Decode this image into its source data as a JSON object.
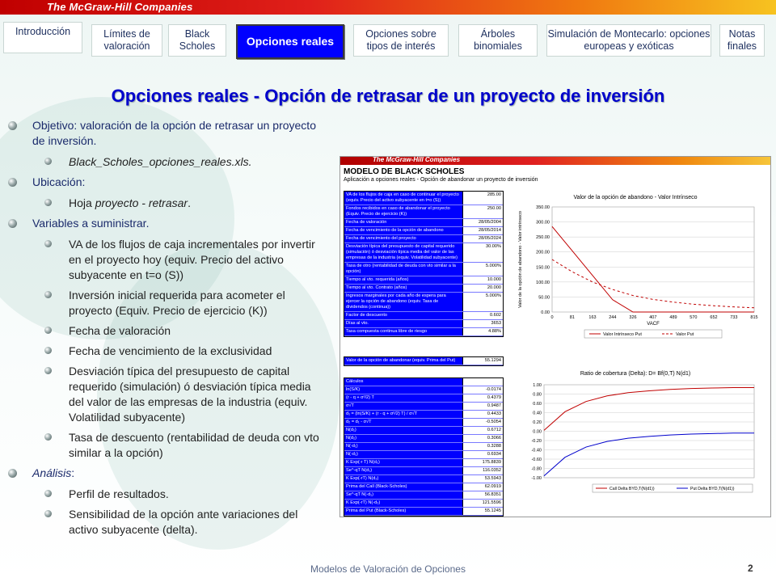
{
  "brand": "The McGraw-Hill Companies",
  "nav": [
    {
      "label": "Introducción"
    },
    {
      "label": "Límites de valoración"
    },
    {
      "label": "Black Scholes"
    },
    {
      "label": "Opciones reales"
    },
    {
      "label": "Opciones sobre tipos de interés"
    },
    {
      "label": "Árboles binomiales"
    },
    {
      "label": "Simulación de Montecarlo: opciones europeas y exóticas"
    },
    {
      "label": "Notas finales"
    }
  ],
  "title": "Opciones reales - Opción de retrasar de un proyecto de inversión",
  "bullets": {
    "objetivo_label": "Objetivo",
    "objetivo_text": ": valoración de la opción de retrasar un proyecto de inversión.",
    "file": "Black_Scholes_opciones_reales.xls.",
    "ubicacion_label": "Ubicación",
    "ubicacion_colon": ":",
    "hoja_prefix": "Hoja ",
    "hoja_name": "proyecto - retrasar",
    "hoja_suffix": ".",
    "variables_label": "Variables a suministrar.",
    "variables": [
      "VA de los flujos de caja incrementales por invertir en el proyecto hoy (equiv. Precio del activo subyacente en t=o (S))",
      "Inversión inicial requerida para acometer el proyecto (Equiv. Precio de ejercicio (K))",
      "Fecha de valoración",
      "Fecha de vencimiento de la exclusividad",
      "Desviación típica del presupuesto de capital requerido (simulación) ó desviación típica media del valor de las empresas de la industria (equiv. Volatilidad subyacente)",
      "Tasa de descuento (rentabilidad de deuda con vto similar a la opción)"
    ],
    "analisis_label": "Análisis",
    "analisis_colon": ":",
    "analisis": [
      "Perfil de resultados.",
      "Sensibilidad de la opción ante variaciones del activo subyacente (delta)."
    ]
  },
  "sheet": {
    "brand": "The McGraw-Hill Companies",
    "heading": "MODELO DE BLACK SCHOLES",
    "subheading": "Aplicación a opciones reales - Opción de abandonar un proyecto de inversión",
    "inputs": [
      {
        "label": "VA de los flujos de caja en caso de continuar el proyecto (equiv. Precio del activo subyacente en t=o (S))",
        "value": "285.00"
      },
      {
        "label": "Fondos recibidos en caso de abandonar el proyecto (Equiv. Precio de ejercicio (K))",
        "value": "250.00"
      },
      {
        "label": "Fecha de valoración",
        "value": "28/05/2004"
      },
      {
        "label": "Fecha de vencimiento de la opción de abandono",
        "value": "28/05/2014"
      },
      {
        "label": "Fecha de vencimiento del proyecto",
        "value": "28/05/2024"
      },
      {
        "label": "Desviación típica del presupuesto de capital requerido (simulación) ó desviación típica media del valor de las empresas de la industria (equiv. Volatilidad subyacente)",
        "value": "30.00%"
      },
      {
        "label": "Tasa de otro (rentabilidad de deuda con vto similar a la opción)",
        "value": "5.000%"
      },
      {
        "label": "Tiempo al vto. requerida (años)",
        "value": "10.000"
      },
      {
        "label": "Tiempo al vto. Contrato (años)",
        "value": "20.000"
      },
      {
        "label": "Ingresos marginales por cada año de espera para ejercer la opción de abandono (equiv. Tasa de dividendos (continua))",
        "value": "5.000%"
      },
      {
        "label": "Factor de descuento",
        "value": "0.602"
      },
      {
        "label": "Días al vto.",
        "value": "3653"
      },
      {
        "label": "Tasa compuesta continua libre de riesgo",
        "value": "4.88%"
      }
    ],
    "put_value_label": "Valor de la opción de abandonar (equiv. Prima del Put)",
    "put_value": "55.1294",
    "calc_header": "Cálculos",
    "calcs": [
      {
        "label": "ln(S/K)",
        "value": "-0.0174"
      },
      {
        "label": "(r - q + σ²/2) T",
        "value": "0.4379"
      },
      {
        "label": "σ√T",
        "value": "0.9487"
      },
      {
        "label": "d₁ = (ln(S/K) + (r - q + σ²/2) T) / σ√T",
        "value": "0.4433"
      },
      {
        "label": "d₂ = d₁ - σ√T",
        "value": "-0.5054"
      },
      {
        "label": "N(d₁)",
        "value": "0.6712"
      },
      {
        "label": "N(d₂)",
        "value": "0.3066"
      },
      {
        "label": "N(-d₁)",
        "value": "0.3288"
      },
      {
        "label": "N(-d₂)",
        "value": "0.6934"
      },
      {
        "label": "K Exp(-r T) N(d₂)",
        "value": "175.8839"
      },
      {
        "label": "Se^-qT N(d₁)",
        "value": "116.0352"
      },
      {
        "label": "K Exp(-rT) N(d₂)",
        "value": "53.5943"
      },
      {
        "label": "Prima del Call (Black-Scholes)",
        "value": "62.0919"
      },
      {
        "label": "Se^-qT N(-d₁)",
        "value": "56.8351"
      },
      {
        "label": "K Exp(-rT) N(-d₂)",
        "value": "121.5596"
      },
      {
        "label": "Prima del Put (Black-Scholes)",
        "value": "55.1245"
      }
    ]
  },
  "chart_data": [
    {
      "type": "line",
      "title": "Valor de la opción de abandono - Valor Intrínseco",
      "xlabel": "VACF",
      "ylabel": "Valor de la opción de abandono - Valor intrínseco",
      "x_ticks": [
        "0",
        "81",
        "163",
        "244",
        "326",
        "407",
        "489",
        "570",
        "652",
        "733",
        "815"
      ],
      "x": [
        0,
        81,
        163,
        244,
        326,
        407,
        489,
        570,
        652,
        733,
        815
      ],
      "ylim": [
        0,
        350
      ],
      "y_ticks": [
        "0.00",
        "50.00",
        "100.00",
        "150.00",
        "200.00",
        "250.00",
        "300.00",
        "350.00"
      ],
      "series": [
        {
          "name": "Valor Intrínseco Put",
          "style": "solid",
          "values": [
            285,
            204,
            122,
            41,
            0,
            0,
            0,
            0,
            0,
            0,
            0
          ]
        },
        {
          "name": "Valor Put",
          "style": "dashed",
          "values": [
            175,
            134,
            100,
            75,
            55,
            42,
            33,
            26,
            21,
            17,
            14
          ]
        }
      ],
      "legend": "bottom",
      "color": "#c00000"
    },
    {
      "type": "line",
      "title": "Ratio de cobertura (Delta): D= Bf(0,T) N(d1)",
      "x": [
        0,
        20,
        40,
        60,
        80,
        100,
        120,
        140,
        160,
        180,
        200
      ],
      "ylim": [
        -1,
        1
      ],
      "y_ticks": [
        "1.00",
        "0.80",
        "0.60",
        "0.40",
        "0.20",
        "0.00",
        "-0.20",
        "-0.40",
        "-0.60",
        "-0.80",
        "-1.00"
      ],
      "series": [
        {
          "name": "Call Delta BYD,T(N(d1))",
          "color": "#c00000",
          "values": [
            0.02,
            0.42,
            0.64,
            0.76,
            0.83,
            0.87,
            0.9,
            0.92,
            0.93,
            0.94,
            0.94
          ]
        },
        {
          "name": "Put Delta BYD,T(N(d1))",
          "color": "#0000cc",
          "values": [
            -0.96,
            -0.56,
            -0.34,
            -0.22,
            -0.15,
            -0.11,
            -0.08,
            -0.06,
            -0.05,
            -0.04,
            -0.04
          ]
        }
      ],
      "legend": "bottom"
    }
  ],
  "footer": "Modelos de Valoración de Opciones",
  "page": "2"
}
